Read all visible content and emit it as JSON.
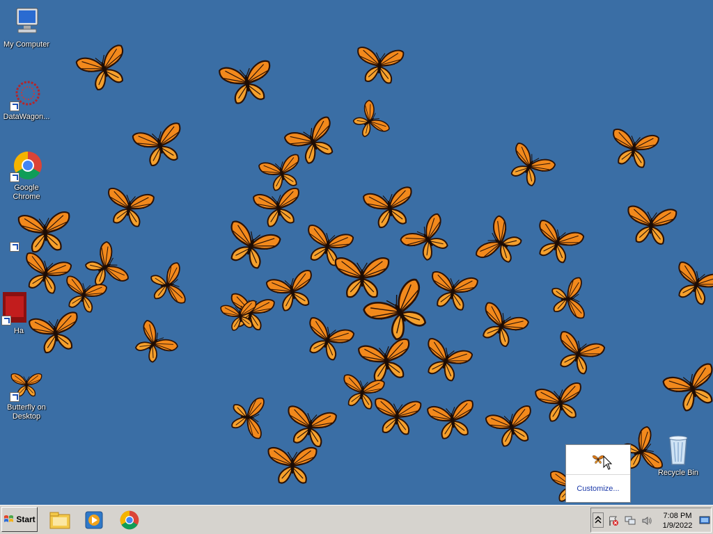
{
  "desktop": {
    "icons": [
      {
        "label": "My Computer",
        "icon": "my-computer-icon"
      },
      {
        "label": "DataWagon...",
        "icon": "datawagon-icon"
      },
      {
        "label": "Google Chrome",
        "icon": "chrome-icon"
      },
      {
        "label": "",
        "icon": "shortcut-icon"
      },
      {
        "label": "Ha",
        "icon": "red-app-icon"
      },
      {
        "label": "Butterfly on Desktop",
        "icon": "butterfly-app-icon"
      },
      {
        "label": "Recycle Bin",
        "icon": "recycle-bin-icon"
      }
    ]
  },
  "tray_popup": {
    "customize_label": "Customize..."
  },
  "taskbar": {
    "start_label": "Start",
    "pinned": [
      "file-explorer-icon",
      "media-player-icon",
      "chrome-icon"
    ],
    "clock": {
      "time": "7:08 PM",
      "date": "1/9/2022"
    }
  },
  "colors": {
    "desktop_bg": "#3a6ea5",
    "taskbar_bg": "#d6d3ce",
    "butterfly_orange": "#f2891c",
    "butterfly_dark": "#2b1206"
  }
}
